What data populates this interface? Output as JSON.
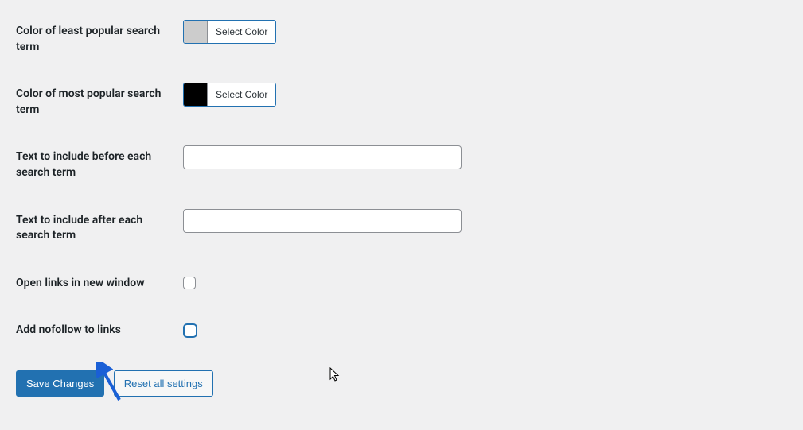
{
  "rows": {
    "least_color": {
      "label": "Color of least popular search term",
      "button": "Select Color",
      "swatch": "#cccccc"
    },
    "most_color": {
      "label": "Color of most popular search term",
      "button": "Select Color",
      "swatch": "#000000"
    },
    "before_text": {
      "label": "Text to include before each search term",
      "value": ""
    },
    "after_text": {
      "label": "Text to include after each search term",
      "value": ""
    },
    "new_window": {
      "label": "Open links in new window",
      "checked": false
    },
    "nofollow": {
      "label": "Add nofollow to links",
      "checked": false
    }
  },
  "buttons": {
    "save": "Save Changes",
    "reset": "Reset all settings"
  }
}
